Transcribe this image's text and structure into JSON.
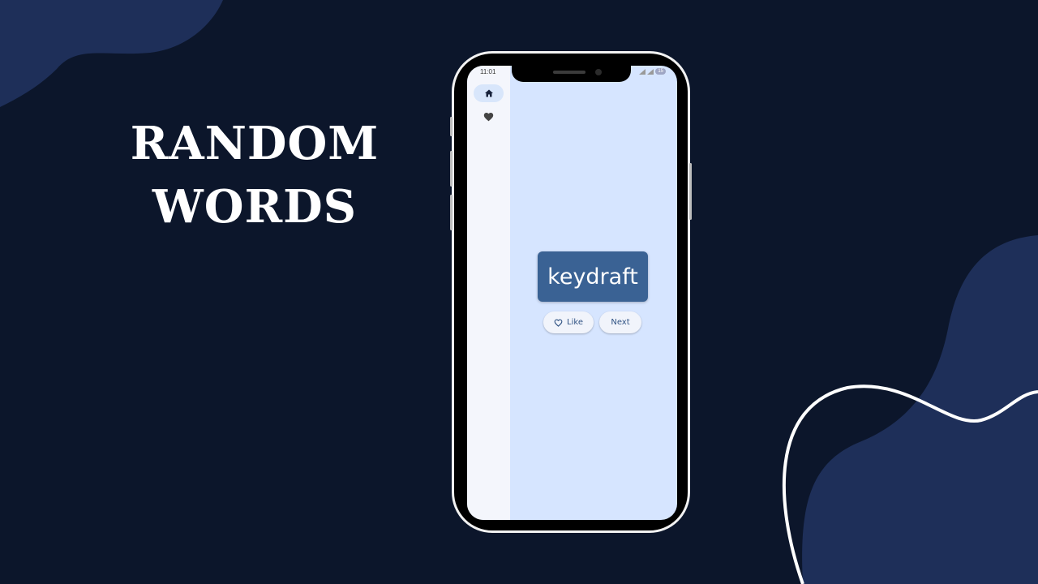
{
  "headline": {
    "line1": "RANDOM",
    "line2": "WORDS"
  },
  "phone": {
    "status_bar": {
      "time": "11:01",
      "battery": "15"
    },
    "nav_rail": {
      "items": [
        {
          "icon": "home-icon",
          "selected": true
        },
        {
          "icon": "heart-icon",
          "selected": false
        }
      ]
    },
    "word_card": {
      "word": "keydraft"
    },
    "buttons": {
      "like_label": "Like",
      "like_icon": "heart-outline-icon",
      "next_label": "Next"
    }
  },
  "colors": {
    "background": "#0c162b",
    "blob": "#1e2f59",
    "card": "#3a6294",
    "screen": "#d6e5ff",
    "rail": "#f4f6fc"
  }
}
